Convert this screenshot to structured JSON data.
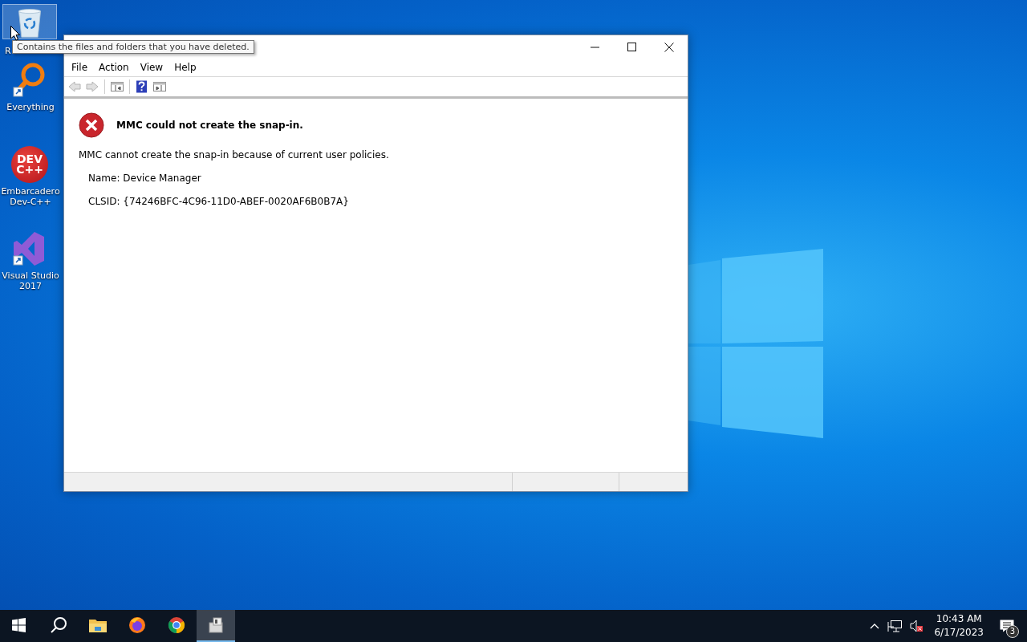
{
  "desktop": {
    "icons": [
      {
        "kind": "recycle",
        "label": "R",
        "selected": true
      },
      {
        "kind": "everything",
        "label": "Everything",
        "selected": false
      },
      {
        "kind": "devcpp",
        "label": "Embarcadero Dev-C++",
        "logo_text": [
          "DEV",
          "C++"
        ],
        "selected": false
      },
      {
        "kind": "vs",
        "label": "Visual Studio 2017",
        "selected": false
      }
    ]
  },
  "tooltip": {
    "text": "Contains the files and folders that you have deleted."
  },
  "window": {
    "menu": [
      "File",
      "Action",
      "View",
      "Help"
    ],
    "toolbar": [
      {
        "kind": "back",
        "disabled": true
      },
      {
        "kind": "forward",
        "disabled": true
      },
      {
        "kind": "sep"
      },
      {
        "kind": "tree",
        "disabled": false
      },
      {
        "kind": "sep"
      },
      {
        "kind": "help",
        "disabled": false
      },
      {
        "kind": "pane",
        "disabled": false
      }
    ],
    "message": {
      "title": "MMC could not create the snap-in.",
      "body": "MMC cannot create the snap-in because of current user policies.",
      "details": [
        "Name: Device Manager",
        "CLSID: {74246BFC-4C96-11D0-ABEF-0020AF6B0B7A}"
      ]
    }
  },
  "taskbar": {
    "apps": [
      {
        "kind": "start",
        "selected": false
      },
      {
        "kind": "search",
        "selected": false
      },
      {
        "kind": "explorer",
        "selected": false
      },
      {
        "kind": "firefox",
        "selected": false
      },
      {
        "kind": "chrome",
        "selected": false
      },
      {
        "kind": "mmc",
        "selected": true
      }
    ],
    "tray": {
      "time": "10:43 AM",
      "date": "6/17/2023",
      "notifications": "3"
    }
  }
}
